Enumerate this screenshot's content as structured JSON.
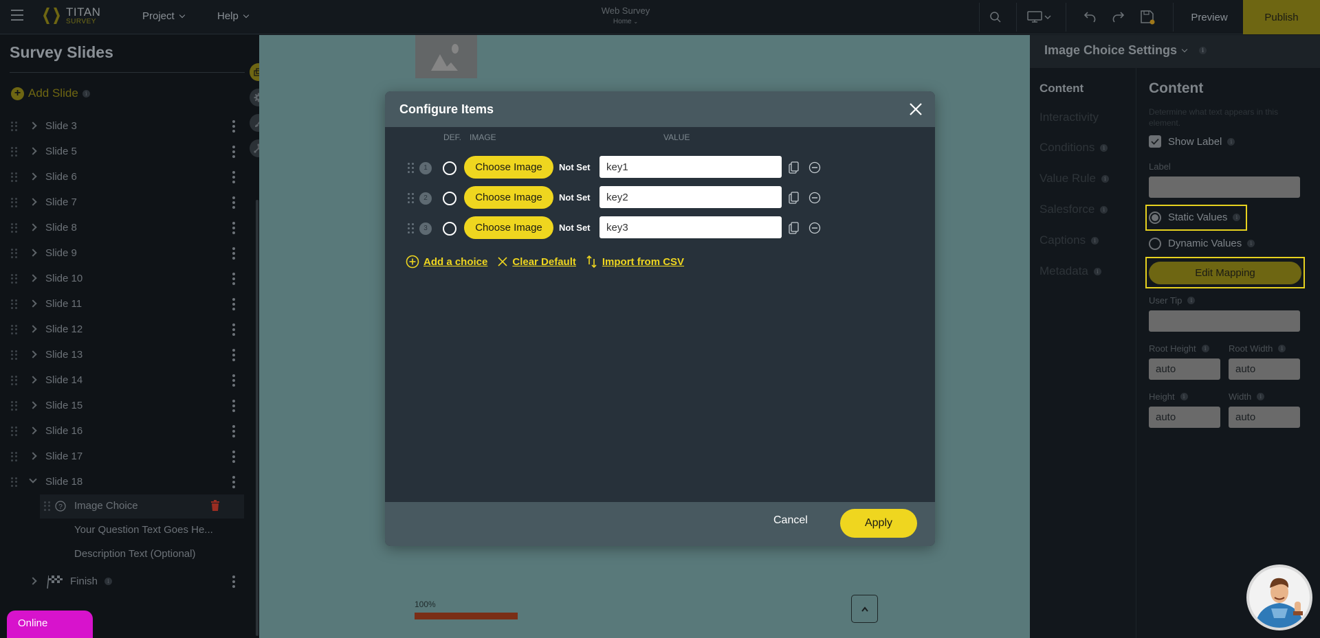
{
  "topbar": {
    "logo_line1": "TITAN",
    "logo_line2": "SURVEY",
    "menus": [
      {
        "label": "Project"
      },
      {
        "label": "Help"
      }
    ],
    "doc_title": "Web Survey",
    "doc_page": "Home",
    "icons": [
      "search-icon",
      "desktop-device-icon",
      "undo-icon",
      "redo-icon",
      "save-icon"
    ],
    "preview_label": "Preview",
    "publish_label": "Publish"
  },
  "sidebar": {
    "title": "Survey Slides",
    "add_slide_label": "Add Slide",
    "info_glyph": "i",
    "slides": [
      {
        "label": "Slide 3",
        "expanded": false
      },
      {
        "label": "Slide 5",
        "expanded": false
      },
      {
        "label": "Slide 6",
        "expanded": false
      },
      {
        "label": "Slide 7",
        "expanded": false
      },
      {
        "label": "Slide 8",
        "expanded": false
      },
      {
        "label": "Slide 9",
        "expanded": false
      },
      {
        "label": "Slide 10",
        "expanded": false
      },
      {
        "label": "Slide 11",
        "expanded": false
      },
      {
        "label": "Slide 12",
        "expanded": false
      },
      {
        "label": "Slide 13",
        "expanded": false
      },
      {
        "label": "Slide 14",
        "expanded": false
      },
      {
        "label": "Slide 15",
        "expanded": false
      },
      {
        "label": "Slide 16",
        "expanded": false
      },
      {
        "label": "Slide 17",
        "expanded": false
      },
      {
        "label": "Slide 18",
        "expanded": true
      }
    ],
    "slide18_children": [
      {
        "label": "Image Choice",
        "selected": true
      },
      {
        "label": "Your Question Text Goes He..."
      },
      {
        "label": "Description Text (Optional)"
      }
    ],
    "finish_label": "Finish",
    "online_label": "Online"
  },
  "canvas": {
    "progress_label": "100%",
    "progress_value": 1.0
  },
  "modal": {
    "title": "Configure Items",
    "columns": {
      "def": "DEF.",
      "image": "IMAGE",
      "value": "VALUE"
    },
    "items": [
      {
        "index": "1",
        "choose_label": "Choose Image",
        "status": "Not Set",
        "value": "key1",
        "is_default": false
      },
      {
        "index": "2",
        "choose_label": "Choose Image",
        "status": "Not Set",
        "value": "key2",
        "is_default": false
      },
      {
        "index": "3",
        "choose_label": "Choose Image",
        "status": "Not Set",
        "value": "key3",
        "is_default": false
      }
    ],
    "actions": {
      "add_choice": "Add a choice",
      "clear_default": "Clear Default",
      "import_csv": "Import from CSV"
    },
    "cancel_label": "Cancel",
    "apply_label": "Apply"
  },
  "right_panel": {
    "title": "Image Choice Settings",
    "nav": [
      {
        "label": "Content",
        "active": true,
        "info": false
      },
      {
        "label": "Interactivity",
        "active": false,
        "info": false
      },
      {
        "label": "Conditions",
        "active": false,
        "info": true
      },
      {
        "label": "Value Rule",
        "active": false,
        "info": true
      },
      {
        "label": "Salesforce",
        "active": false,
        "info": true
      },
      {
        "label": "Captions",
        "active": false,
        "info": true
      },
      {
        "label": "Metadata",
        "active": false,
        "info": true
      }
    ],
    "content": {
      "heading": "Content",
      "description": "Determine what text appears in this element.",
      "show_label": "Show Label",
      "show_label_checked": true,
      "label_field_label": "Label",
      "label_value": "",
      "static_values": "Static Values",
      "dynamic_values": "Dynamic Values",
      "value_mode": "static",
      "edit_mapping": "Edit Mapping",
      "user_tip_label": "User Tip",
      "user_tip_value": "",
      "root_height_label": "Root Height",
      "root_height_value": "auto",
      "root_width_label": "Root Width",
      "root_width_value": "auto",
      "height_label": "Height",
      "height_value": "auto",
      "width_label": "Width",
      "width_value": "auto"
    },
    "highlight_color": "#e7d21f"
  },
  "colors": {
    "accent_yellow": "#efd61f",
    "publish_bg": "#6e6612",
    "online_badge": "#d713cc",
    "progress_fill": "#7a2e16",
    "canvas_bg": "#59797a"
  }
}
